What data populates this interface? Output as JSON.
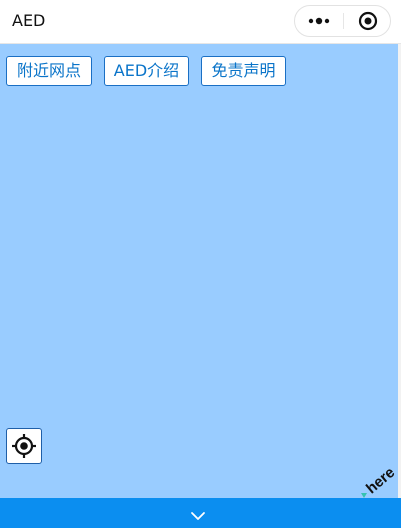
{
  "window": {
    "title": "AED"
  },
  "capsule": {
    "more_icon": "more-dots-icon",
    "close_icon": "close-circle-icon"
  },
  "tabs": [
    {
      "label": "附近网点"
    },
    {
      "label": "AED介绍"
    },
    {
      "label": "免责声明"
    }
  ],
  "map": {
    "background_color": "#99ccff",
    "attribution": "here",
    "locate_icon": "crosshair-icon"
  },
  "bottom_bar": {
    "color": "#0b8ef0",
    "icon": "chevron-down-icon"
  }
}
